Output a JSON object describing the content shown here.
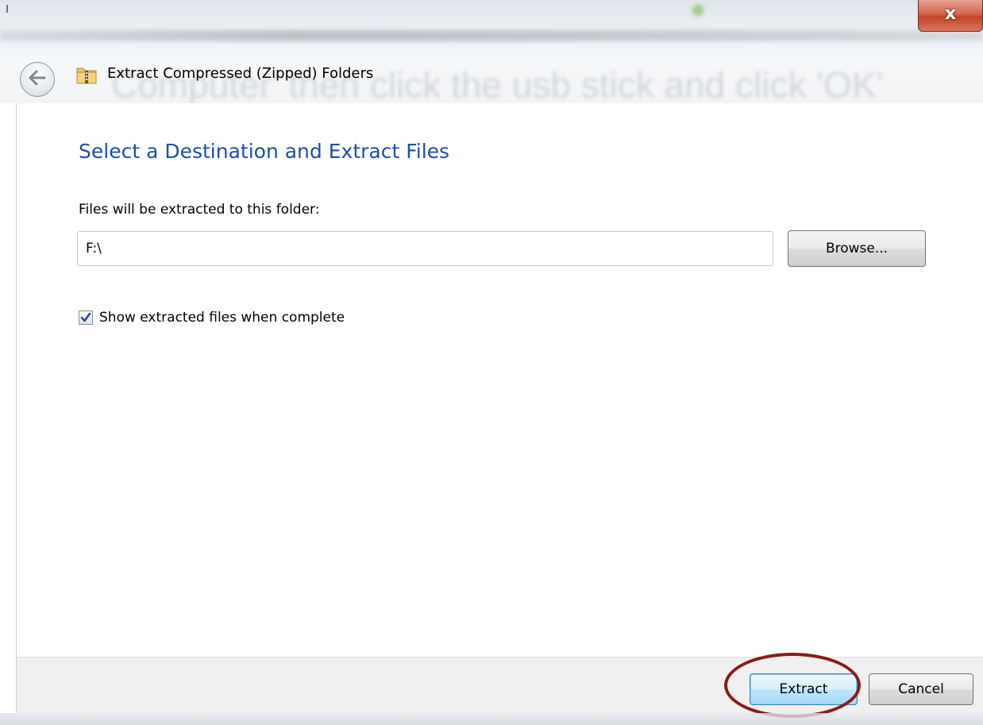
{
  "window": {
    "title": "Extract Compressed (Zipped) Folders",
    "close_label": "x"
  },
  "background_overlay_text": "Computer' then click the usb stick and click 'OK'",
  "content": {
    "heading": "Select a Destination and Extract Files",
    "destination_label": "Files will be extracted to this folder:",
    "destination_value": "F:\\",
    "browse_label": "Browse...",
    "show_files_checkbox": {
      "label": "Show extracted files when complete",
      "checked": true
    }
  },
  "footer": {
    "extract_label": "Extract",
    "cancel_label": "Cancel"
  },
  "colors": {
    "heading": "#1e4fa5",
    "highlight_ring": "#8b1a1a",
    "close_button": "#c24428",
    "footer_bg": "#f0f0f0"
  },
  "icons": {
    "back": "back-arrow-icon",
    "folder": "zip-folder-icon",
    "close": "close-icon",
    "checkmark": "checkmark-icon"
  }
}
